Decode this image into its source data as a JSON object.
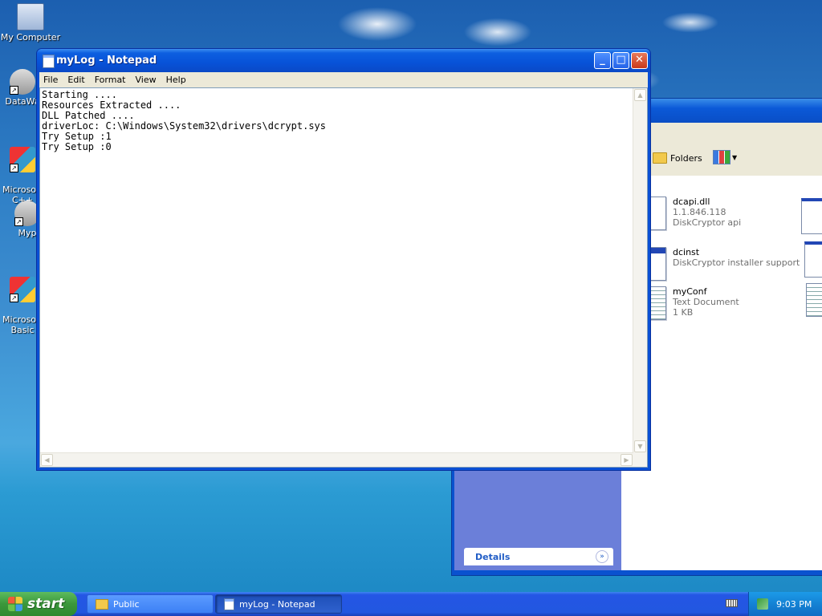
{
  "desktop": {
    "icons": [
      {
        "label": "My Computer"
      },
      {
        "label": "DataWa"
      },
      {
        "label": "Microsoft\nC++"
      },
      {
        "label": "Myp"
      },
      {
        "label": "Microsoft\nBasic"
      }
    ]
  },
  "notepad": {
    "title": "myLog - Notepad",
    "menu": [
      "File",
      "Edit",
      "Format",
      "View",
      "Help"
    ],
    "content": "Starting ....\nResources Extracted ....\nDLL Patched ....\ndriverLoc: C:\\Windows\\System32\\drivers\\dcrypt.sys\nTry Setup :1\nTry Setup :0"
  },
  "explorer": {
    "toolbar": {
      "folders_label": "Folders"
    },
    "details_label": "Details",
    "files": [
      {
        "name": "dcapi.dll",
        "line2": "1.1.846.118",
        "line3": "DiskCryptor api"
      },
      {
        "name": "dcinst",
        "line2": "DiskCryptor installer support",
        "line3": ""
      },
      {
        "name": "myConf",
        "line2": "Text Document",
        "line3": "1 KB"
      }
    ]
  },
  "taskbar": {
    "start_label": "start",
    "tasks": [
      {
        "label": "Public"
      },
      {
        "label": "myLog - Notepad"
      }
    ],
    "clock": "9:03 PM"
  },
  "colors": {
    "title_blue": "#0a4fd4",
    "start_green": "#3b973b",
    "taskbar_blue": "#2257e0",
    "tray_blue": "#1482d4"
  }
}
